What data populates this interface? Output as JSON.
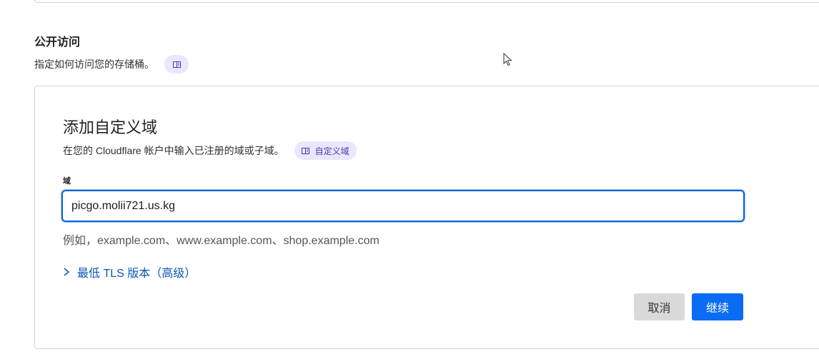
{
  "public_access": {
    "title": "公开访问",
    "description": "指定如何访问您的存储桶。"
  },
  "custom_domain_panel": {
    "title": "添加自定义域",
    "description": "在您的 Cloudflare 帐户中输入已注册的域或子域。",
    "doc_link_label": "自定义域",
    "field_label": "域",
    "domain_value": "picgo.molii721.us.kg",
    "hint": "例如，example.com、www.example.com、shop.example.com",
    "advanced_toggle_label": "最低 TLS 版本（高级）",
    "cancel_label": "取消",
    "continue_label": "继续"
  },
  "icons": {
    "doc": "book-icon",
    "expand": "chevron-right-icon",
    "pointer": "mouse-cursor-icon"
  },
  "colors": {
    "accent": "#0a6cf2",
    "link": "#0a56b9",
    "pill_bg": "#eae6ff",
    "pill_fg": "#4c3aa8",
    "cancel_bg": "#d9d9d9"
  }
}
